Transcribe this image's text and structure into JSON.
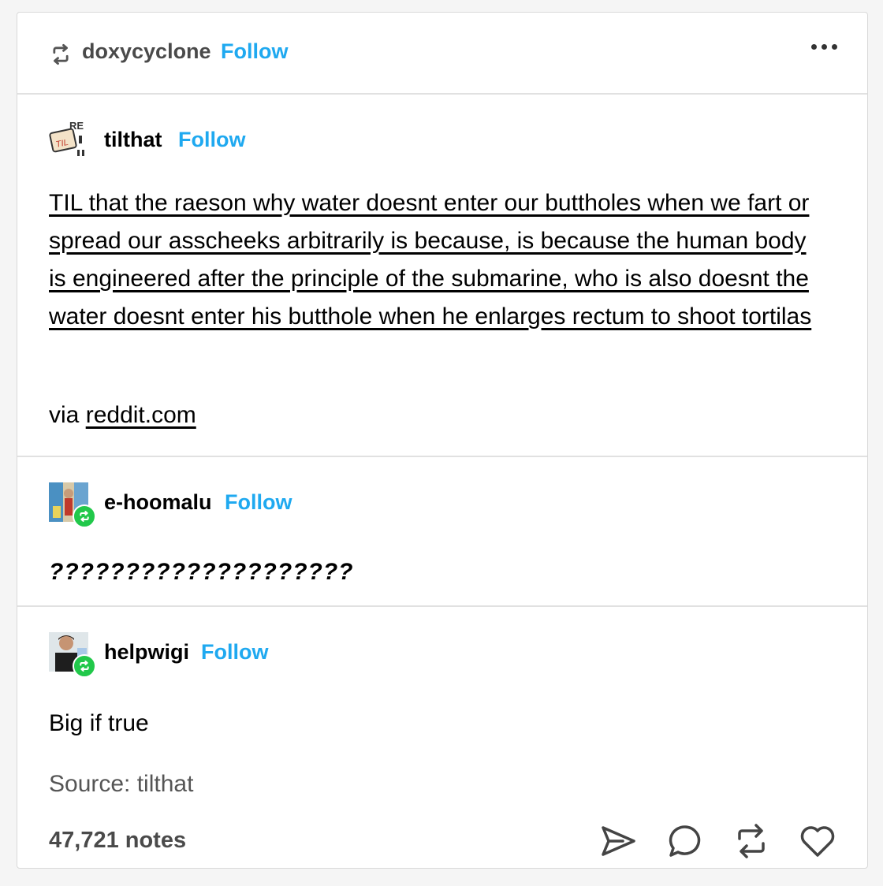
{
  "header": {
    "username": "doxycyclone",
    "follow_label": "Follow"
  },
  "posts": [
    {
      "username": "tilthat",
      "follow_label": "Follow",
      "body": "TIL that the raeson why water doesnt enter our buttholes when we fart or spread our asscheeks arbitrarily is because, is because the human body is engineered after the principle of the submarine, who is also doesnt the water doesnt enter his butthole when he enlarges rectum to shoot tortilas",
      "via_prefix": "via",
      "via_link": "reddit.com"
    },
    {
      "username": "e-hoomalu",
      "follow_label": "Follow",
      "body": "????????????????????"
    },
    {
      "username": "helpwigi",
      "follow_label": "Follow",
      "body": "Big if true"
    }
  ],
  "footer": {
    "source": "Source: tilthat",
    "notes": "47,721 notes"
  },
  "icons": {
    "share": "send-icon",
    "reply": "reply-icon",
    "reblog": "reblog-icon",
    "like": "heart-icon"
  },
  "colors": {
    "follow": "#1fa9f0",
    "badge": "#21c84a"
  }
}
